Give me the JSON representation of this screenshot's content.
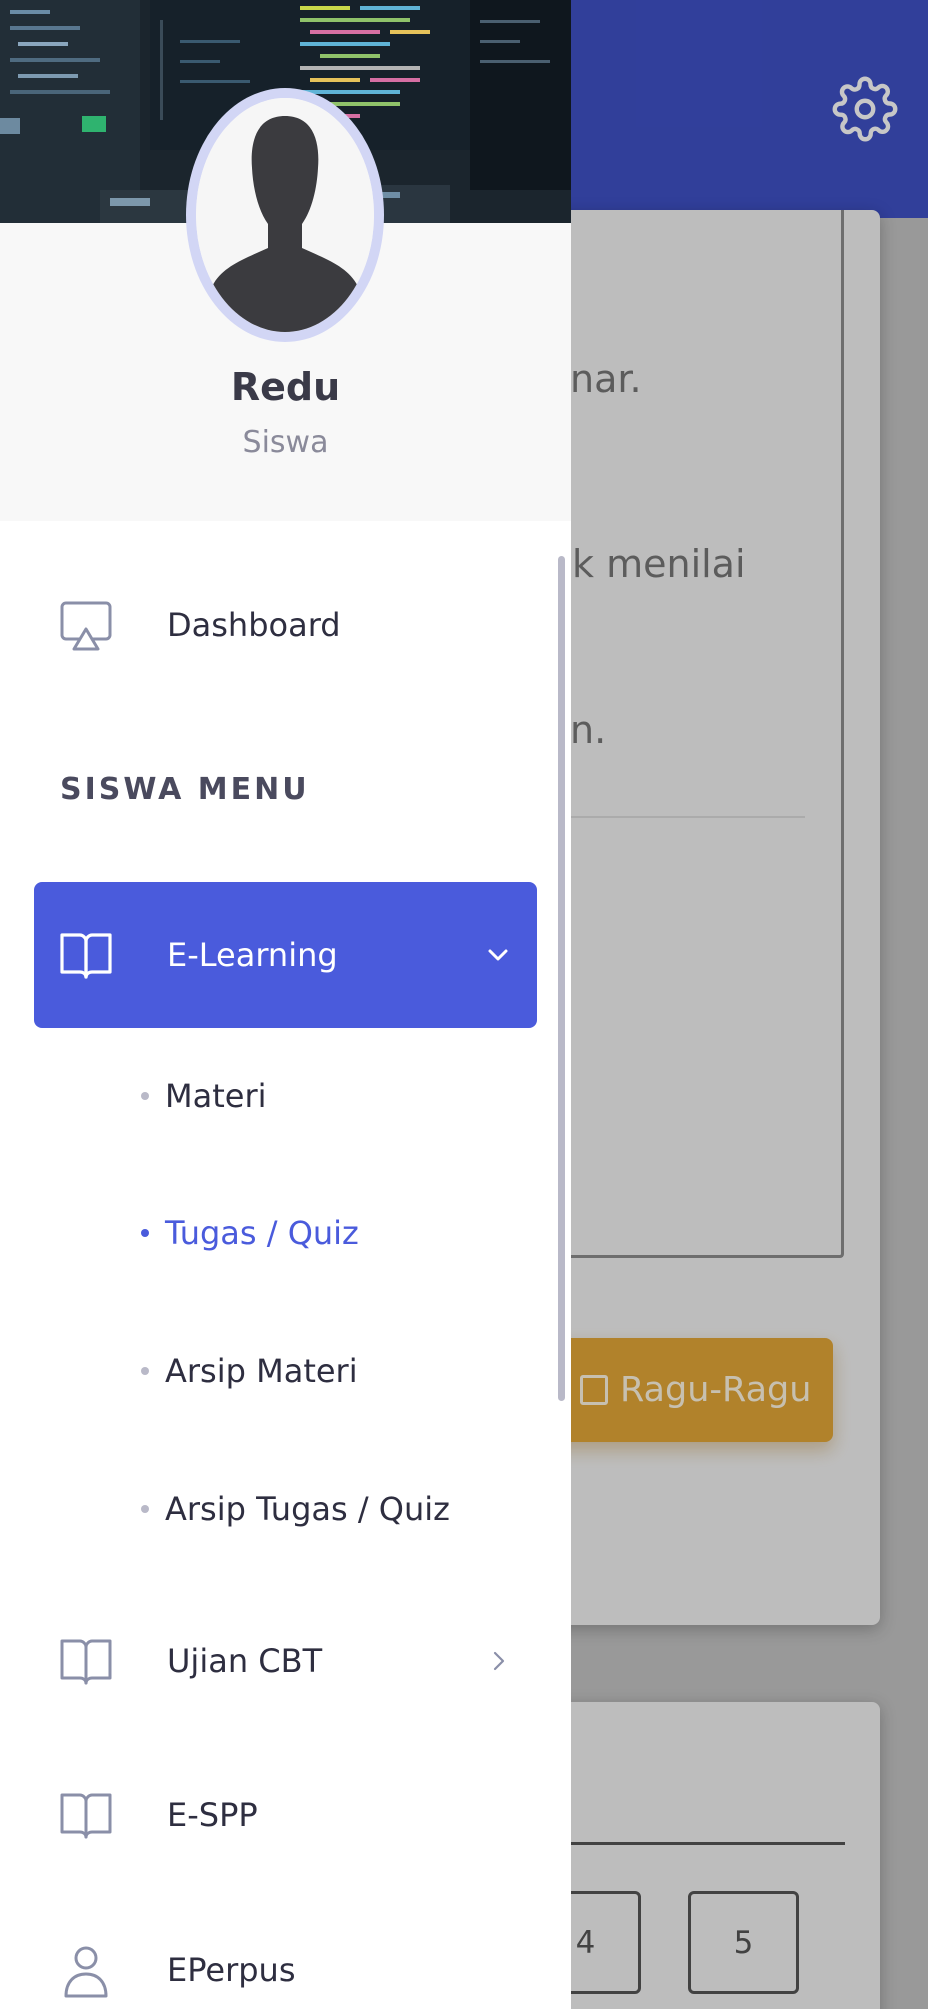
{
  "background": {
    "question_fragments": [
      "nar.",
      "k menilai",
      "n."
    ],
    "ragu_button_label": "Ragu-Ragu",
    "number_boxes": [
      "4",
      "5"
    ],
    "colors": {
      "topbar": "#3f51c6",
      "ragu": "#e3a738"
    }
  },
  "drawer": {
    "user": {
      "name": "Redu",
      "role": "Siswa"
    },
    "dashboard_label": "Dashboard",
    "section_label": "SISWA MENU",
    "elearning": {
      "label": "E-Learning",
      "submenu": [
        "Materi",
        "Tugas / Quiz",
        "Arsip Materi",
        "Arsip Tugas / Quiz"
      ],
      "active_submenu": "Tugas / Quiz"
    },
    "items": [
      {
        "label": "Ujian CBT",
        "icon": "book-icon"
      },
      {
        "label": "E-SPP",
        "icon": "book-icon"
      },
      {
        "label": "EPerpus",
        "icon": "user-icon"
      }
    ],
    "colors": {
      "accent": "#4a5bdc"
    }
  }
}
